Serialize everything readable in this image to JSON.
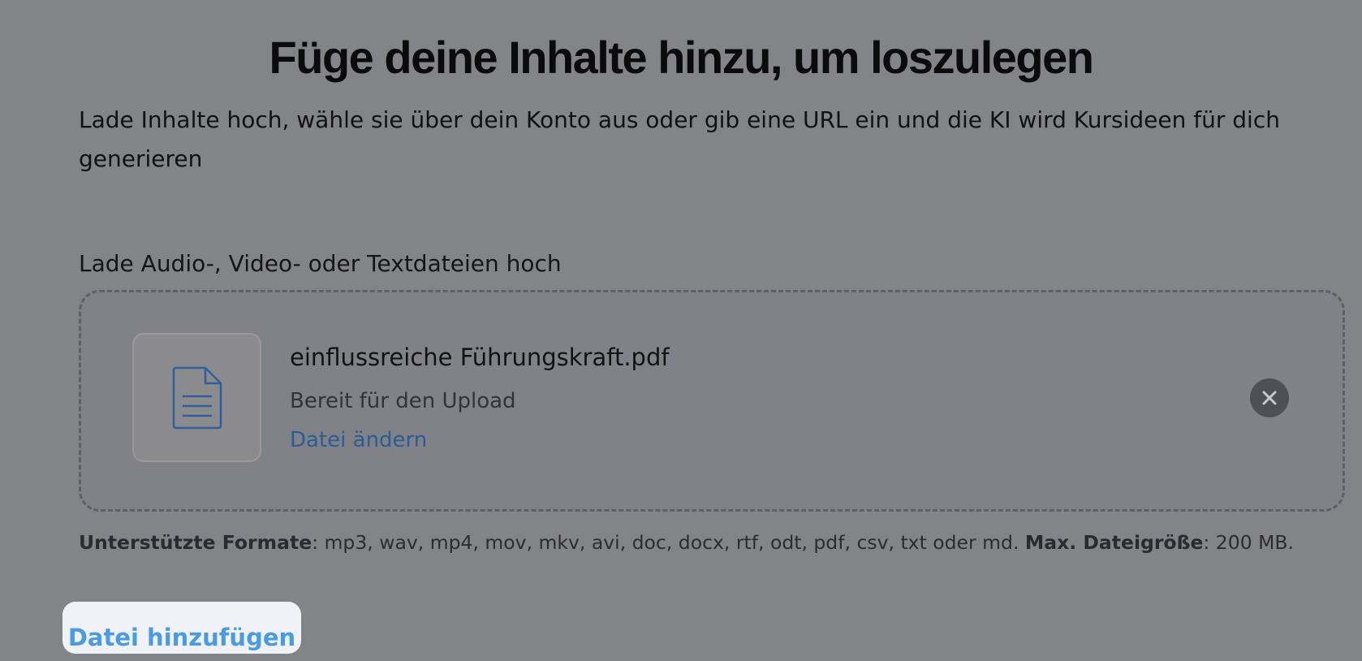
{
  "page": {
    "title": "Füge deine Inhalte hinzu, um loszulegen",
    "subtitle": "Lade Inhalte hoch, wähle sie über dein Konto aus oder gib eine URL ein und die KI wird Kursideen für dich generieren"
  },
  "upload": {
    "section_label": "Lade Audio-, Video- oder Textdateien hoch",
    "file": {
      "icon": "document-icon",
      "name": "einflussreiche Führungskraft.pdf",
      "status": "Bereit für den Upload",
      "change_label": "Datei ändern"
    },
    "remove_icon": "close-icon",
    "formats_label": "Unterstützte Formate",
    "formats_list": ": mp3, wav, mp4, mov, mkv, avi, doc, docx, rtf, odt, pdf, csv, txt oder md.",
    "max_size_label": "Max. Dateigröße",
    "max_size_value": ": 200 MB.",
    "add_file_label": "Datei hinzufügen"
  },
  "colors": {
    "overlay_background": "#838487",
    "link": "#2a5c96",
    "button_text": "#4a9be6",
    "button_background": "#f1f2f7"
  }
}
